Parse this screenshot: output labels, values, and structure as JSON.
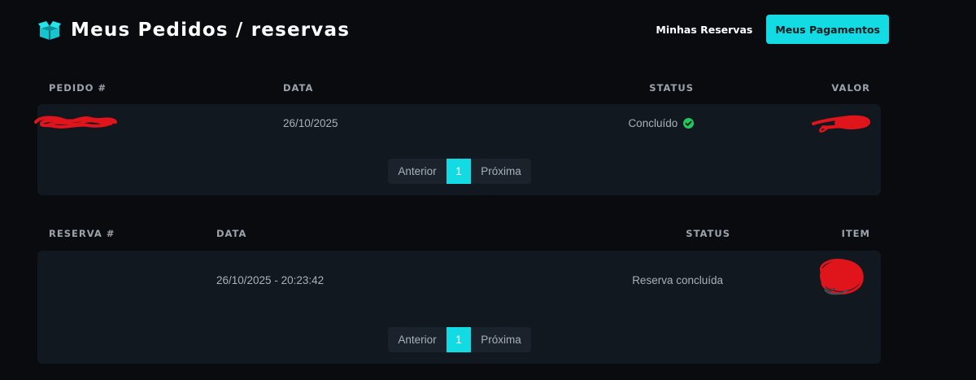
{
  "header": {
    "title": "Meus Pedidos / reservas",
    "icon": "box-icon",
    "nav_link": "Minhas Reservas",
    "nav_button": "Meus Pagamentos",
    "accent_color": "#13dbe4"
  },
  "orders": {
    "columns": [
      "PEDIDO #",
      "DATA",
      "STATUS",
      "VALOR"
    ],
    "rows": [
      {
        "date": "26/10/2025",
        "status": "Concluído",
        "status_icon": "check-circle-icon",
        "status_color": "#22c55e"
      }
    ],
    "pagination": {
      "prev": "Anterior",
      "current": "1",
      "next": "Próxima"
    }
  },
  "reservations": {
    "columns": [
      "RESERVA #",
      "DATA",
      "STATUS",
      "ITEM"
    ],
    "rows": [
      {
        "date": "26/10/2025 - 20:23:42",
        "status": "Reserva concluída"
      }
    ],
    "pagination": {
      "prev": "Anterior",
      "current": "1",
      "next": "Próxima"
    }
  },
  "redaction_color": "#e0141b"
}
